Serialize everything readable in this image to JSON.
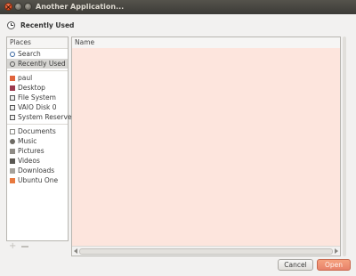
{
  "window": {
    "title": "Another Application..."
  },
  "header": {
    "current_location": "Recently Used"
  },
  "places": {
    "heading": "Places",
    "groups": [
      [
        {
          "label": "Search",
          "icon": "search-icon"
        },
        {
          "label": "Recently Used",
          "icon": "clock-icon",
          "selected": true
        }
      ],
      [
        {
          "label": "paul",
          "icon": "home-folder-icon"
        },
        {
          "label": "Desktop",
          "icon": "desktop-icon"
        },
        {
          "label": "File System",
          "icon": "drive-icon"
        },
        {
          "label": "VAIO Disk 0",
          "icon": "drive-icon"
        },
        {
          "label": "System Reserved",
          "icon": "drive-icon"
        }
      ],
      [
        {
          "label": "Documents",
          "icon": "documents-folder-icon"
        },
        {
          "label": "Music",
          "icon": "music-folder-icon"
        },
        {
          "label": "Pictures",
          "icon": "pictures-folder-icon"
        },
        {
          "label": "Videos",
          "icon": "videos-folder-icon"
        },
        {
          "label": "Downloads",
          "icon": "downloads-folder-icon"
        },
        {
          "label": "Ubuntu One",
          "icon": "ubuntu-one-icon"
        }
      ]
    ]
  },
  "filelist": {
    "column_name": "Name"
  },
  "buttons": {
    "cancel": "Cancel",
    "open": "Open"
  },
  "colors": {
    "accent": "#e8826a",
    "list_background": "#fde5dd",
    "titlebar": "#3c3b37"
  }
}
